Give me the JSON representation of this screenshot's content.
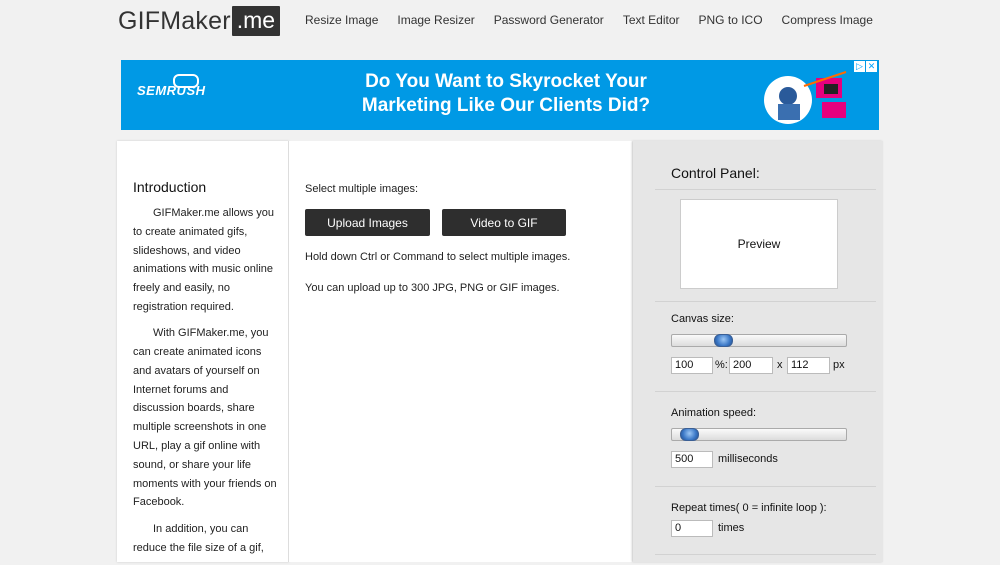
{
  "header": {
    "logo_main": "GIFMaker",
    "logo_box": ".me",
    "nav": [
      "Resize Image",
      "Image Resizer",
      "Password Generator",
      "Text Editor",
      "PNG to ICO",
      "Compress Image"
    ]
  },
  "banner": {
    "brand": "SEMRUSH",
    "line1": "Do You Want to Skyrocket Your",
    "line2": "Marketing Like Our Clients Did?",
    "background_color": "#0099e5"
  },
  "intro": {
    "title": "Introduction",
    "p1": "GIFMaker.me allows you to create animated gifs, slideshows, and video animations with music online freely and easily, no registration required.",
    "p2": "With GIFMaker.me, you can create animated icons and avatars of yourself on Internet forums and discussion boards, share multiple screenshots in one URL, play a gif online with sound, or share your life moments with your friends on Facebook.",
    "p3": "In addition, you can reduce the file size of a gif,"
  },
  "upload": {
    "select_label": "Select multiple images:",
    "upload_btn": "Upload Images",
    "video_btn": "Video to GIF",
    "hint1": "Hold down Ctrl or Command to select multiple images.",
    "hint2": "You can upload up to 300 JPG, PNG or GIF images."
  },
  "control_panel": {
    "title": "Control Panel:",
    "preview": "Preview",
    "canvas_label": "Canvas size:",
    "canvas_slider_level": 0.27,
    "canvas_percent": "100",
    "percent_sep": "%:",
    "canvas_width": "200",
    "x_sep": "x",
    "canvas_height": "112",
    "px_unit": "px",
    "speed_label": "Animation speed:",
    "speed_slider_level": 0.05,
    "speed_value": "500",
    "speed_unit": "milliseconds",
    "repeat_label": "Repeat times( 0 = infinite loop ):",
    "repeat_value": "0",
    "repeat_unit": "times"
  }
}
